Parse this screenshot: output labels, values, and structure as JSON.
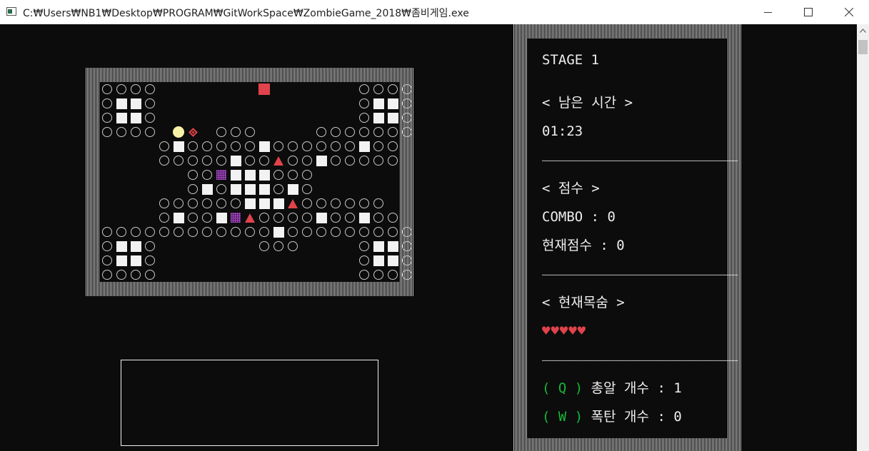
{
  "window": {
    "title": "C:₩Users₩NB1₩Desktop₩PROGRAM₩GitWorkSpace₩ZombieGame_2018₩좀비게임.exe"
  },
  "map": {
    "rows": [
      "oooo.......Z......oooo",
      "oWWo..............oWWo",
      "oWWo..............oWWo",
      "oooo.Pd.ooo....ooooooo",
      "....oWoooooWooooooWoo.",
      "....oooooWooTooWooooo.",
      "......ooGWWWooo.......",
      "......oWoWWWoWo.......",
      "....ooooooWWWToooooo..",
      "....oWooWGTooooWooWoo.",
      "ooooooooooooWooooooooo",
      "oWWo.......ooo....oWWo",
      "oWWo..............oWWo",
      "oooo..............oooo"
    ]
  },
  "panel": {
    "stage": "STAGE 1",
    "time_header": "< 남은 시간 >",
    "time_value": "01:23",
    "divider": "________________________",
    "score_header": "< 점수 >",
    "combo": "COMBO : 0",
    "current_score": "현재점수 : 0",
    "lives_header": "< 현재목숨 >",
    "lives": "♥♥♥♥♥",
    "lives_count": 5,
    "bullet_key": "( Q )",
    "bullet_text": " 총알 개수 : 1",
    "bomb_key": "( W )",
    "bomb_text": " 폭탄 개수 : 0"
  },
  "colors": {
    "background": "#0c0c0c",
    "zombie": "#e0434b",
    "player": "#f8f1a8",
    "item": "#a04bb8",
    "key_hint": "#14b83a",
    "text": "#eeeeee"
  }
}
